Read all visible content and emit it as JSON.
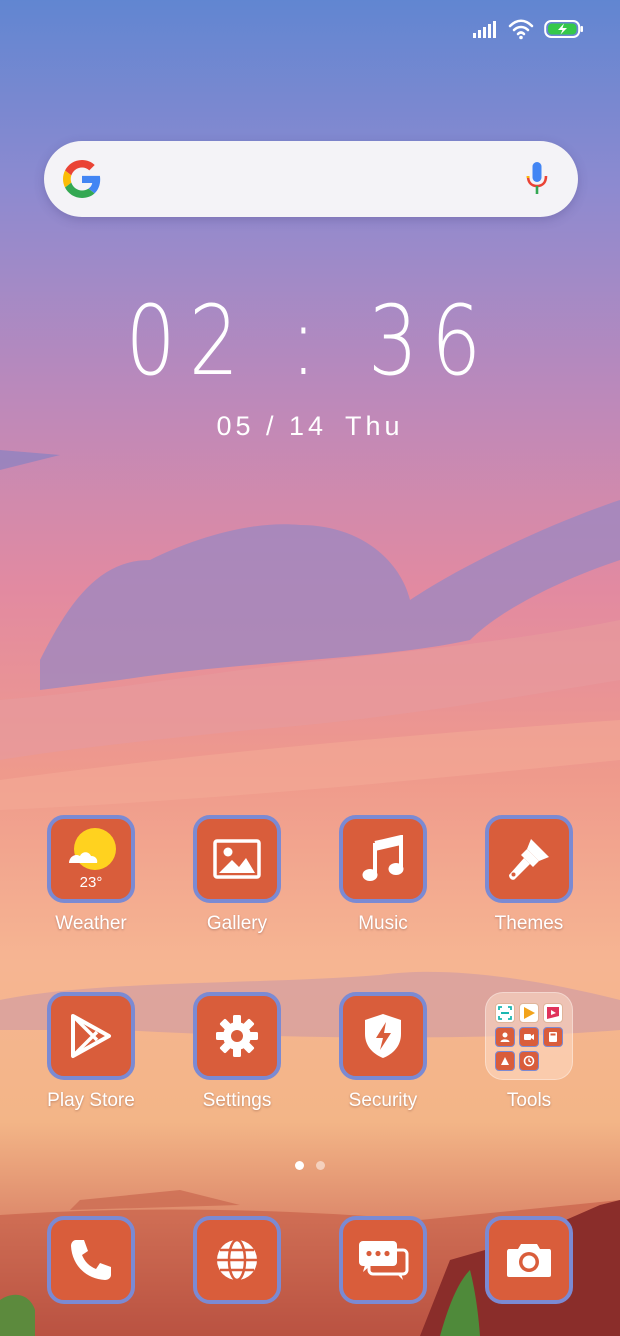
{
  "search": {
    "provider_icon": "google-g-icon",
    "voice_icon": "mic-icon"
  },
  "clock": {
    "time": "02 : 36",
    "date": "05 / 14",
    "weekday": "Thu"
  },
  "status_bar": {
    "icons": [
      "cellular-signal-icon",
      "wifi-icon",
      "battery-charging-icon"
    ]
  },
  "apps": [
    {
      "label": "Weather",
      "icon": "weather-sun-icon",
      "temperature": "23°"
    },
    {
      "label": "Gallery",
      "icon": "image-icon"
    },
    {
      "label": "Music",
      "icon": "music-note-icon"
    },
    {
      "label": "Themes",
      "icon": "paintbrush-icon"
    },
    {
      "label": "Play Store",
      "icon": "play-store-icon"
    },
    {
      "label": "Settings",
      "icon": "gear-icon"
    },
    {
      "label": "Security",
      "icon": "shield-icon"
    },
    {
      "label": "Tools",
      "icon": "folder-icon"
    }
  ],
  "dock": [
    {
      "name": "Phone",
      "icon": "phone-icon"
    },
    {
      "name": "Browser",
      "icon": "globe-icon"
    },
    {
      "name": "Messaging",
      "icon": "chat-icon"
    },
    {
      "name": "Camera",
      "icon": "camera-icon"
    }
  ],
  "page_indicator": {
    "total": 2,
    "current": 1
  },
  "colors": {
    "tile": "#d95d3b",
    "tile_border": "#7b8ad3",
    "label": "#ffffff",
    "battery": "#35c84a"
  }
}
